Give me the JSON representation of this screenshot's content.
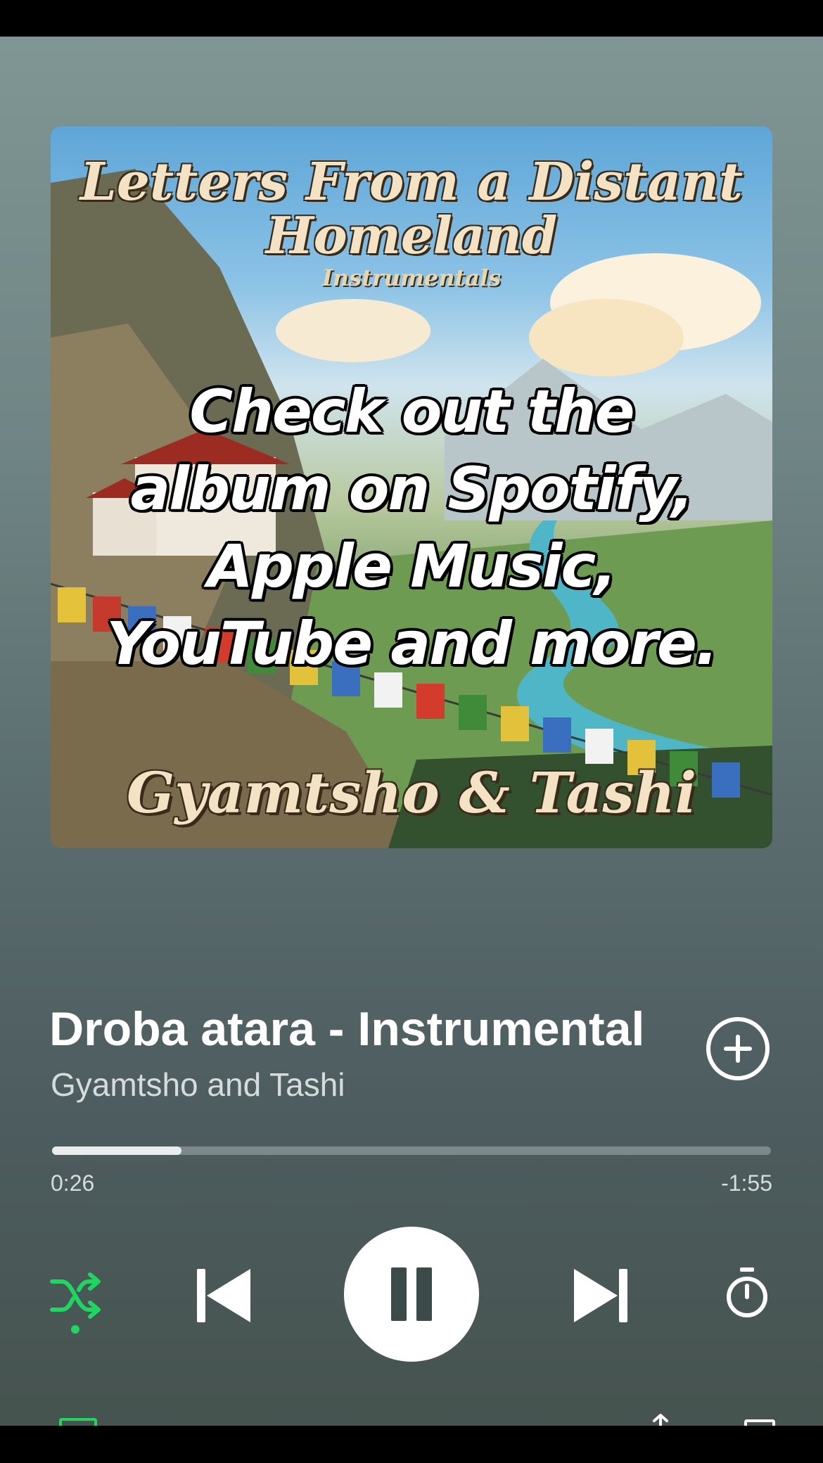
{
  "album_art": {
    "title_line1": "Letters From a Distant",
    "title_line2": "Homeland",
    "subtitle": "Instrumentals",
    "promo_text": "Check out the album on Spotify, Apple Music, YouTube and more.",
    "artist": "Gyamtsho & Tashi"
  },
  "track": {
    "title": "Droba atara - Instrumental",
    "artist": "Gyamtsho and Tashi"
  },
  "progress": {
    "elapsed": "0:26",
    "remaining": "-1:55",
    "fraction": 0.18
  },
  "controls": {
    "shuffle_icon": "shuffle-icon",
    "previous_icon": "skip-previous-icon",
    "play_pause_icon": "pause-icon",
    "next_icon": "skip-next-icon",
    "timer_icon": "sleep-timer-icon",
    "add_icon": "add-circle-icon"
  },
  "colors": {
    "accent": "#1ed760",
    "background_top": "#7f9694",
    "background_bottom": "#46534f"
  }
}
